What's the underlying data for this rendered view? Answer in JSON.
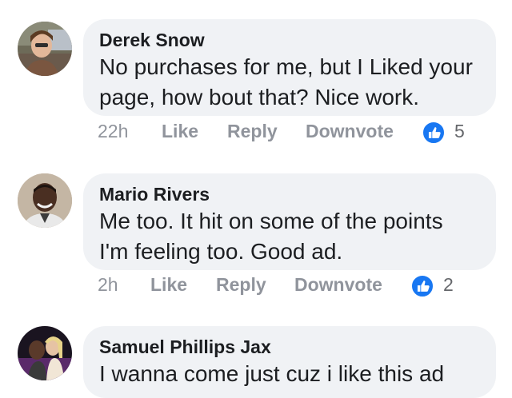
{
  "comments": [
    {
      "author": "Derek Snow",
      "text_lines": [
        "No purchases for me, but I Liked your",
        "page, how bout that? Nice work."
      ],
      "time": "22h",
      "like_label": "Like",
      "reply_label": "Reply",
      "downvote_label": "Downvote",
      "reaction_icon": "thumbs-up-icon",
      "reaction_count": "5"
    },
    {
      "author": "Mario Rivers",
      "text_lines": [
        "Me too. It hit on some of the points",
        "I'm feeling too. Good ad."
      ],
      "time": "2h",
      "like_label": "Like",
      "reply_label": "Reply",
      "downvote_label": "Downvote",
      "reaction_icon": "thumbs-up-icon",
      "reaction_count": "2"
    },
    {
      "author": "Samuel Phillips Jax",
      "text_lines": [
        "I wanna come just cuz i like this ad"
      ]
    }
  ],
  "colors": {
    "bubble": "#f0f2f5",
    "meta": "#90949c",
    "like_blue": "#1877f2"
  }
}
